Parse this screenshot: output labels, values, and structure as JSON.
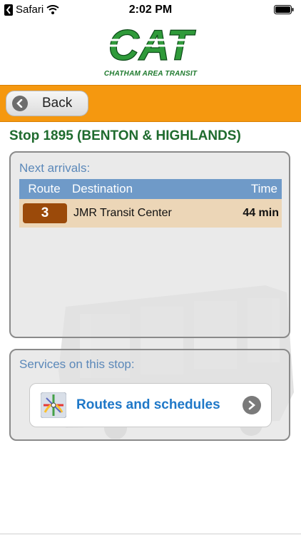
{
  "status_bar": {
    "carrier": "Safari",
    "time": "2:02 PM"
  },
  "logo": {
    "word": "CAT",
    "subtitle": "CHATHAM AREA TRANSIT"
  },
  "nav": {
    "back_label": "Back"
  },
  "stop": {
    "title": "Stop 1895 (BENTON & HIGHLANDS)"
  },
  "arrivals": {
    "heading": "Next arrivals:",
    "columns": {
      "route": "Route",
      "destination": "Destination",
      "time": "Time"
    },
    "rows": [
      {
        "route": "3",
        "destination": "JMR Transit Center",
        "time": "44 min"
      }
    ]
  },
  "services": {
    "heading": "Services on this stop:",
    "routes_button_label": "Routes and schedules"
  },
  "colors": {
    "navbar": "#f5980f",
    "title_green": "#1f6b2e",
    "heading_blue": "#5b88b9",
    "table_header": "#6f9ac8",
    "row_bg": "#ecd6b7",
    "route_badge": "#9b4a0a",
    "link_blue": "#1f78c8"
  },
  "icons": [
    "back-arrow-icon",
    "wifi-icon",
    "battery-icon",
    "back-circle-icon",
    "route-map-icon",
    "chevron-right-icon"
  ]
}
